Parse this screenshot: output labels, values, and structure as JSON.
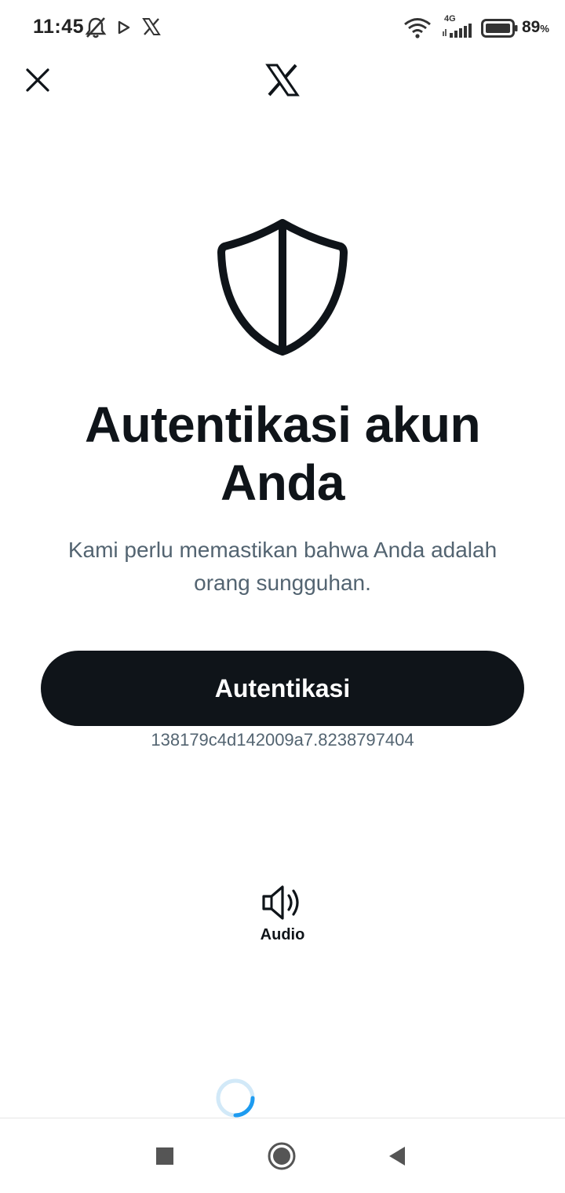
{
  "status_bar": {
    "time": "11:45",
    "network_label": "4G",
    "battery_percent": "89",
    "battery_unit": "%",
    "icons": [
      "bell-off-icon",
      "play-icon",
      "x-logo-icon",
      "wifi-icon",
      "cellular-signal-icon",
      "battery-icon"
    ]
  },
  "header": {
    "close_icon": "close-icon",
    "logo_icon": "x-logo-icon"
  },
  "main": {
    "icon": "shield-icon",
    "title": "Autentikasi akun Anda",
    "subtitle": "Kami perlu memastikan bahwa Anda adalah orang sungguhan.",
    "button_label": "Autentikasi",
    "token": "138179c4d142009a7.8238797404",
    "audio_label": "Audio"
  },
  "nav_bar": {
    "icons": [
      "recents-square-icon",
      "home-circle-icon",
      "back-triangle-icon"
    ]
  },
  "colors": {
    "primary_text": "#0f1419",
    "secondary_text": "#536471",
    "button_bg": "#0f1419",
    "spinner_accent": "#1d9bf0"
  }
}
